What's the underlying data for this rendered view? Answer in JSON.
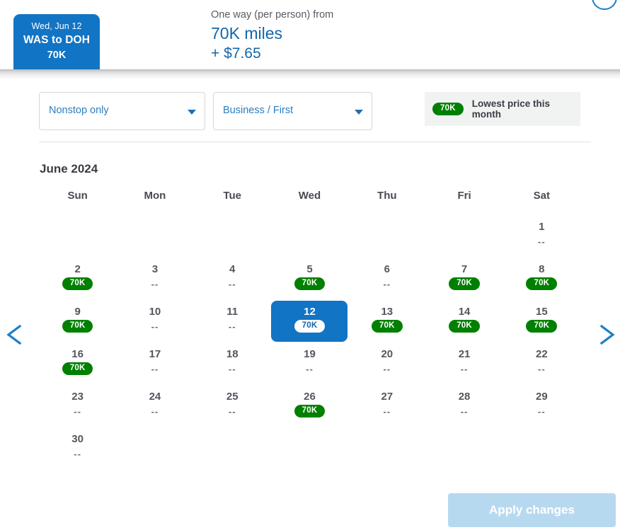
{
  "header": {
    "trip_tab": {
      "date": "Wed, Jun 12",
      "route": "WAS to DOH",
      "miles": "70K"
    },
    "price": {
      "caption": "One way (per person) from",
      "miles": "70K miles",
      "taxes": "+ $7.65"
    }
  },
  "filters": {
    "stops": {
      "value": "Nonstop only"
    },
    "cabin": {
      "value": "Business / First"
    },
    "legend": {
      "badge": "70K",
      "text": "Lowest price this month"
    }
  },
  "calendar": {
    "month_title": "June 2024",
    "weekdays": [
      "Sun",
      "Mon",
      "Tue",
      "Wed",
      "Thu",
      "Fri",
      "Sat"
    ],
    "empty_value": "--",
    "weeks": [
      [
        {
          "day": "",
          "value": "",
          "empty": true
        },
        {
          "day": "",
          "value": "",
          "empty": true
        },
        {
          "day": "",
          "value": "",
          "empty": true
        },
        {
          "day": "",
          "value": "",
          "empty": true
        },
        {
          "day": "",
          "value": "",
          "empty": true
        },
        {
          "day": "",
          "value": "",
          "empty": true
        },
        {
          "day": "1",
          "value": "--",
          "badge": false,
          "selected": false
        }
      ],
      [
        {
          "day": "2",
          "value": "70K",
          "badge": true,
          "selected": false
        },
        {
          "day": "3",
          "value": "--",
          "badge": false,
          "selected": false
        },
        {
          "day": "4",
          "value": "--",
          "badge": false,
          "selected": false
        },
        {
          "day": "5",
          "value": "70K",
          "badge": true,
          "selected": false
        },
        {
          "day": "6",
          "value": "--",
          "badge": false,
          "selected": false
        },
        {
          "day": "7",
          "value": "70K",
          "badge": true,
          "selected": false
        },
        {
          "day": "8",
          "value": "70K",
          "badge": true,
          "selected": false
        }
      ],
      [
        {
          "day": "9",
          "value": "70K",
          "badge": true,
          "selected": false
        },
        {
          "day": "10",
          "value": "--",
          "badge": false,
          "selected": false
        },
        {
          "day": "11",
          "value": "--",
          "badge": false,
          "selected": false
        },
        {
          "day": "12",
          "value": "70K",
          "badge": true,
          "selected": true
        },
        {
          "day": "13",
          "value": "70K",
          "badge": true,
          "selected": false
        },
        {
          "day": "14",
          "value": "70K",
          "badge": true,
          "selected": false
        },
        {
          "day": "15",
          "value": "70K",
          "badge": true,
          "selected": false
        }
      ],
      [
        {
          "day": "16",
          "value": "70K",
          "badge": true,
          "selected": false
        },
        {
          "day": "17",
          "value": "--",
          "badge": false,
          "selected": false
        },
        {
          "day": "18",
          "value": "--",
          "badge": false,
          "selected": false
        },
        {
          "day": "19",
          "value": "--",
          "badge": false,
          "selected": false
        },
        {
          "day": "20",
          "value": "--",
          "badge": false,
          "selected": false
        },
        {
          "day": "21",
          "value": "--",
          "badge": false,
          "selected": false
        },
        {
          "day": "22",
          "value": "--",
          "badge": false,
          "selected": false
        }
      ],
      [
        {
          "day": "23",
          "value": "--",
          "badge": false,
          "selected": false
        },
        {
          "day": "24",
          "value": "--",
          "badge": false,
          "selected": false
        },
        {
          "day": "25",
          "value": "--",
          "badge": false,
          "selected": false
        },
        {
          "day": "26",
          "value": "70K",
          "badge": true,
          "selected": false
        },
        {
          "day": "27",
          "value": "--",
          "badge": false,
          "selected": false
        },
        {
          "day": "28",
          "value": "--",
          "badge": false,
          "selected": false
        },
        {
          "day": "29",
          "value": "--",
          "badge": false,
          "selected": false
        }
      ],
      [
        {
          "day": "30",
          "value": "--",
          "badge": false,
          "selected": false
        },
        {
          "day": "",
          "value": "",
          "empty": true
        },
        {
          "day": "",
          "value": "",
          "empty": true
        },
        {
          "day": "",
          "value": "",
          "empty": true
        },
        {
          "day": "",
          "value": "",
          "empty": true
        },
        {
          "day": "",
          "value": "",
          "empty": true
        },
        {
          "day": "",
          "value": "",
          "empty": true
        }
      ]
    ]
  },
  "nav": {
    "prev_icon": "chevron-left-icon",
    "next_icon": "chevron-right-icon"
  },
  "footer": {
    "apply_label": "Apply changes"
  },
  "colors": {
    "brand_blue": "#1274c4",
    "link_blue": "#1266ad",
    "badge_green": "#008000",
    "legend_bg": "#f1f2f2",
    "apply_disabled": "#b7d9f0"
  }
}
